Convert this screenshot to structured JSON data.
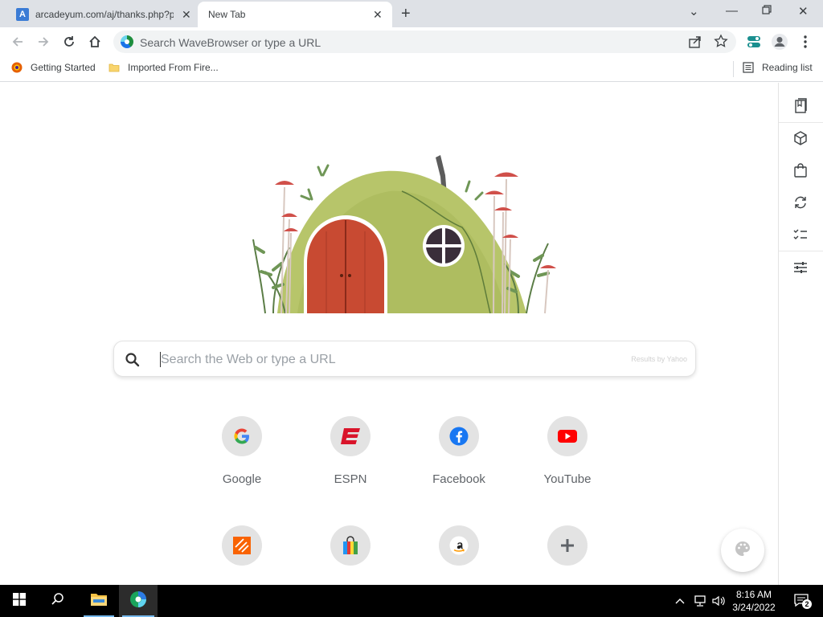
{
  "tabs": [
    {
      "title": "arcadeyum.com/aj/thanks.php?p",
      "favicon_letter": "A",
      "active": false
    },
    {
      "title": "New Tab",
      "active": true
    }
  ],
  "toolbar": {
    "omnibox_placeholder": "Search WaveBrowser or type a URL"
  },
  "bookmarks": {
    "items": [
      {
        "label": "Getting Started",
        "icon": "firefox-icon"
      },
      {
        "label": "Imported From Fire...",
        "icon": "folder-icon"
      }
    ],
    "reading_list": "Reading list"
  },
  "search": {
    "placeholder": "Search the Web or type a URL",
    "provider_note": "Results by Yahoo"
  },
  "shortcuts": [
    {
      "label": "Google",
      "icon": "google-icon"
    },
    {
      "label": "ESPN",
      "icon": "espn-icon"
    },
    {
      "label": "Facebook",
      "icon": "facebook-icon"
    },
    {
      "label": "YouTube",
      "icon": "youtube-icon"
    },
    {
      "label": "",
      "icon": "home-depot-icon"
    },
    {
      "label": "",
      "icon": "shopping-bag-icon"
    },
    {
      "label": "",
      "icon": "amazon-icon"
    },
    {
      "label": "",
      "icon": "add-shortcut-icon"
    }
  ],
  "sidebar": {
    "items": [
      "bookmark-icon",
      "box-icon",
      "shopping-bag-icon",
      "refresh-icon",
      "checklist-icon",
      "sliders-icon"
    ]
  },
  "taskbar": {
    "time": "8:16 AM",
    "date": "3/24/2022",
    "notification_count": "2"
  },
  "colors": {
    "tabstrip": "#dee1e6",
    "accent": "#1a73e8",
    "tile_bg": "#e3e3e3"
  }
}
